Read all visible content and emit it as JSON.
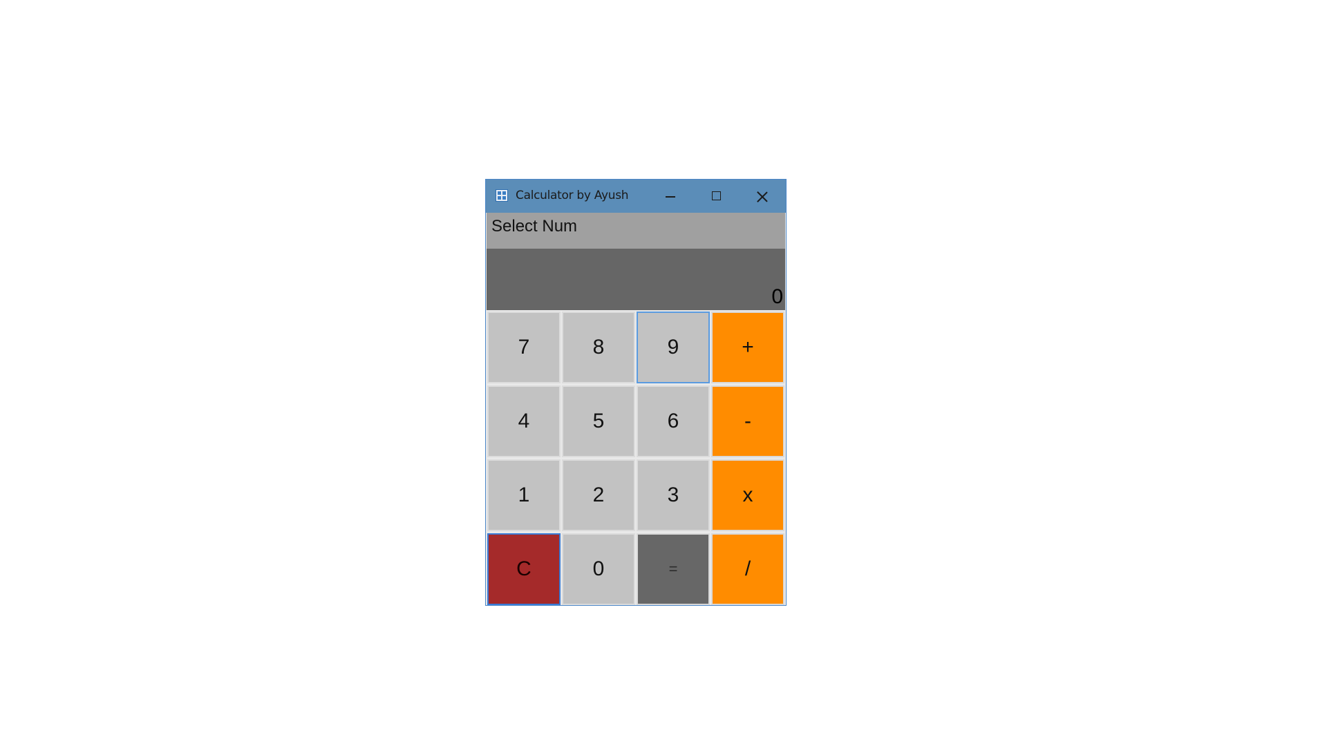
{
  "window": {
    "title": "Calculator by Ayush",
    "title_icon": "app-grid-icon",
    "controls": {
      "minimize": "minimize-icon",
      "maximize": "maximize-icon",
      "close": "close-icon"
    }
  },
  "status": {
    "text": "Select Num"
  },
  "display": {
    "value": "0"
  },
  "keypad": {
    "keys": [
      {
        "label": "7",
        "kind": "num"
      },
      {
        "label": "8",
        "kind": "num"
      },
      {
        "label": "9",
        "kind": "num"
      },
      {
        "label": "+",
        "kind": "op"
      },
      {
        "label": "4",
        "kind": "num"
      },
      {
        "label": "5",
        "kind": "num"
      },
      {
        "label": "6",
        "kind": "num"
      },
      {
        "label": "-",
        "kind": "op"
      },
      {
        "label": "1",
        "kind": "num"
      },
      {
        "label": "2",
        "kind": "num"
      },
      {
        "label": "3",
        "kind": "num"
      },
      {
        "label": "x",
        "kind": "op"
      },
      {
        "label": "C",
        "kind": "clear"
      },
      {
        "label": "0",
        "kind": "num"
      },
      {
        "label": "=",
        "kind": "equals"
      },
      {
        "label": "/",
        "kind": "op"
      }
    ]
  },
  "colors": {
    "titlebar": "#5b8db8",
    "status_bg": "#a0a0a0",
    "display_bg": "#666666",
    "number_key": "#c2c2c2",
    "operator_key": "#ff8c00",
    "clear_key": "#a52a2a",
    "equals_key": "#676767"
  }
}
